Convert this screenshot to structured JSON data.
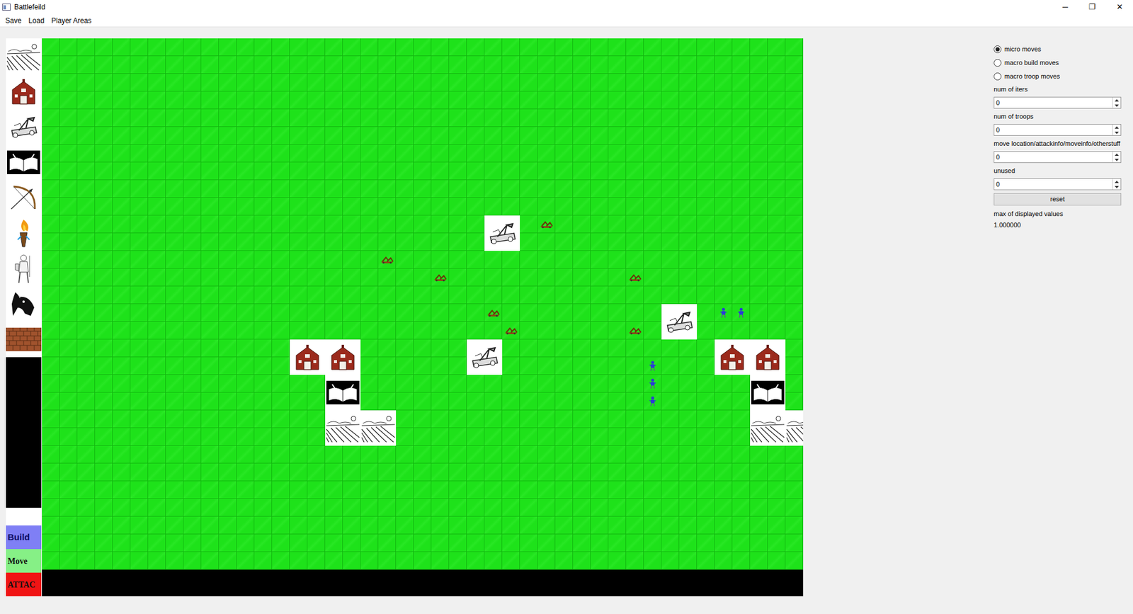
{
  "window": {
    "title": "Battlefeild",
    "controls": [
      "─",
      "❐",
      "✕"
    ]
  },
  "menu": [
    "Save",
    "Load",
    "Player Areas"
  ],
  "actions": [
    {
      "label": "Build",
      "color": "#7f7ff5"
    },
    {
      "label": "Move",
      "color": "#86f086"
    },
    {
      "label": "ATTAC",
      "color": "#f01414"
    }
  ],
  "map": {
    "cols": 43,
    "rows": 30,
    "pieces": [
      {
        "kind": "catapult",
        "col": 25,
        "row": 10
      },
      {
        "kind": "catapult",
        "col": 35,
        "row": 15
      },
      {
        "kind": "catapult",
        "col": 24,
        "row": 17
      },
      {
        "kind": "barn",
        "col": 14,
        "row": 17
      },
      {
        "kind": "barn",
        "col": 16,
        "row": 17
      },
      {
        "kind": "book",
        "col": 16,
        "row": 19
      },
      {
        "kind": "farm",
        "col": 16,
        "row": 21
      },
      {
        "kind": "farm",
        "col": 18,
        "row": 21
      },
      {
        "kind": "barn",
        "col": 38,
        "row": 17
      },
      {
        "kind": "barn",
        "col": 40,
        "row": 17
      },
      {
        "kind": "book",
        "col": 40,
        "row": 19
      },
      {
        "kind": "farm",
        "col": 40,
        "row": 21
      },
      {
        "kind": "farm",
        "col": 42,
        "row": 21
      },
      {
        "kind": "siege",
        "col": 28,
        "row": 10
      },
      {
        "kind": "siege",
        "col": 19,
        "row": 12
      },
      {
        "kind": "siege",
        "col": 22,
        "row": 13
      },
      {
        "kind": "siege",
        "col": 33,
        "row": 13
      },
      {
        "kind": "siege",
        "col": 25,
        "row": 15
      },
      {
        "kind": "siege",
        "col": 26,
        "row": 16
      },
      {
        "kind": "siege",
        "col": 33,
        "row": 16
      },
      {
        "kind": "soldier",
        "col": 38,
        "row": 15
      },
      {
        "kind": "soldier",
        "col": 39,
        "row": 15
      },
      {
        "kind": "soldier",
        "col": 34,
        "row": 18
      },
      {
        "kind": "soldier",
        "col": 34,
        "row": 19
      },
      {
        "kind": "soldier",
        "col": 34,
        "row": 20
      }
    ]
  },
  "options": [
    {
      "label": "micro moves",
      "selected": true
    },
    {
      "label": "macro build moves",
      "selected": false
    },
    {
      "label": "macro troop moves",
      "selected": false
    }
  ],
  "fields": [
    {
      "label": "num of iters",
      "value": "0"
    },
    {
      "label": "num of troops",
      "value": "0"
    },
    {
      "label": "move location/attackinfo/moveinfo/otherstuff",
      "value": "0"
    },
    {
      "label": "unused",
      "value": "0"
    }
  ],
  "reset": "reset",
  "max": {
    "label": "max of displayed values",
    "value": "1.000000"
  }
}
